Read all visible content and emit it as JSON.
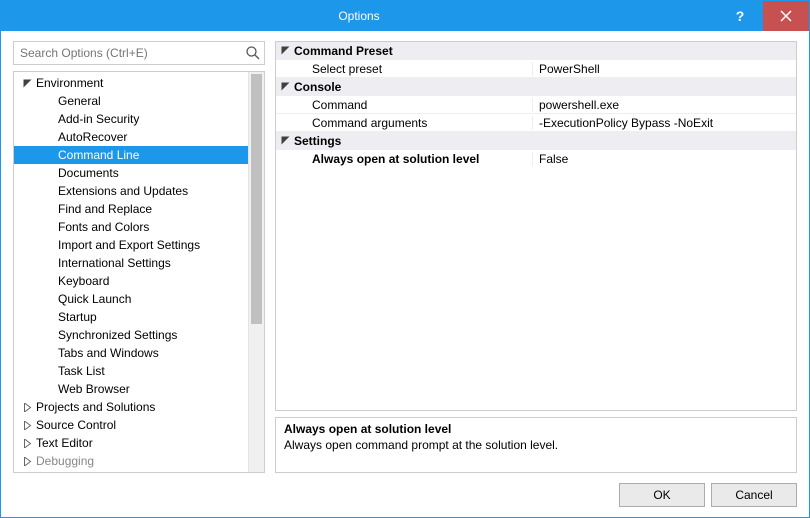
{
  "window": {
    "title": "Options",
    "help_aria": "Help",
    "close_aria": "Close"
  },
  "search": {
    "placeholder": "Search Options (Ctrl+E)",
    "icon": "search-icon"
  },
  "tree": {
    "nodes": [
      {
        "label": "Environment",
        "depth": 0,
        "expander": "open"
      },
      {
        "label": "General",
        "depth": 1
      },
      {
        "label": "Add-in Security",
        "depth": 1
      },
      {
        "label": "AutoRecover",
        "depth": 1
      },
      {
        "label": "Command Line",
        "depth": 1,
        "selected": true
      },
      {
        "label": "Documents",
        "depth": 1
      },
      {
        "label": "Extensions and Updates",
        "depth": 1
      },
      {
        "label": "Find and Replace",
        "depth": 1
      },
      {
        "label": "Fonts and Colors",
        "depth": 1
      },
      {
        "label": "Import and Export Settings",
        "depth": 1
      },
      {
        "label": "International Settings",
        "depth": 1
      },
      {
        "label": "Keyboard",
        "depth": 1
      },
      {
        "label": "Quick Launch",
        "depth": 1
      },
      {
        "label": "Startup",
        "depth": 1
      },
      {
        "label": "Synchronized Settings",
        "depth": 1
      },
      {
        "label": "Tabs and Windows",
        "depth": 1
      },
      {
        "label": "Task List",
        "depth": 1
      },
      {
        "label": "Web Browser",
        "depth": 1
      },
      {
        "label": "Projects and Solutions",
        "depth": 0,
        "expander": "closed"
      },
      {
        "label": "Source Control",
        "depth": 0,
        "expander": "closed"
      },
      {
        "label": "Text Editor",
        "depth": 0,
        "expander": "closed"
      },
      {
        "label": "Debugging",
        "depth": 0,
        "expander": "closed",
        "cut": true
      }
    ]
  },
  "propgrid": [
    {
      "kind": "cat",
      "name": "Command Preset"
    },
    {
      "kind": "item",
      "name": "Select preset",
      "value": "PowerShell"
    },
    {
      "kind": "cat",
      "name": "Console"
    },
    {
      "kind": "item",
      "name": "Command",
      "value": "powershell.exe"
    },
    {
      "kind": "item",
      "name": "Command arguments",
      "value": "-ExecutionPolicy Bypass -NoExit"
    },
    {
      "kind": "cat",
      "name": "Settings"
    },
    {
      "kind": "item",
      "name": "Always open at solution level",
      "value": "False",
      "selected": true
    }
  ],
  "description": {
    "title": "Always open at solution level",
    "text": "Always open command prompt at the solution level."
  },
  "buttons": {
    "ok": "OK",
    "cancel": "Cancel"
  }
}
